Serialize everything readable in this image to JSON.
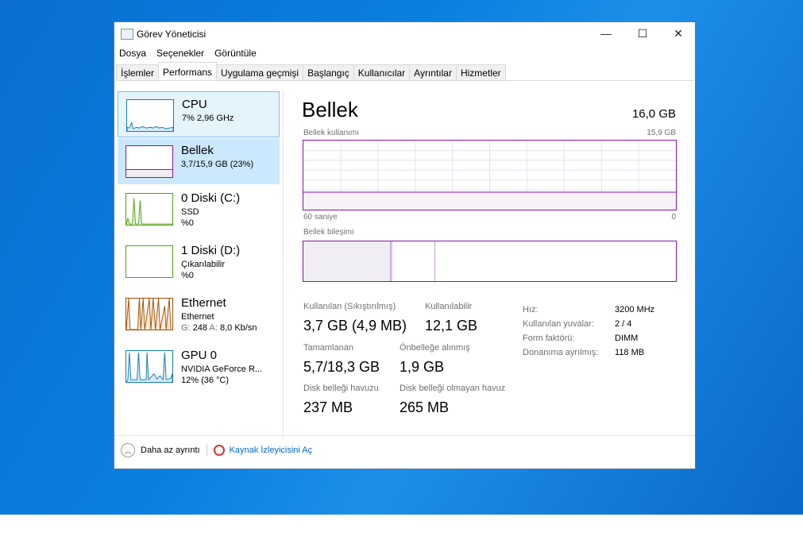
{
  "window": {
    "title": "Görev Yöneticisi",
    "minimize": "—",
    "maximize": "☐",
    "close": "✕"
  },
  "menu": [
    "Dosya",
    "Seçenekler",
    "Görüntüle"
  ],
  "tabs": [
    "İşlemler",
    "Performans",
    "Uygulama geçmişi",
    "Başlangıç",
    "Kullanıcılar",
    "Ayrıntılar",
    "Hizmetler"
  ],
  "sidebar": [
    {
      "name": "CPU",
      "l1": "7% 2,96 GHz",
      "l2": "",
      "color": "#117dbb"
    },
    {
      "name": "Bellek",
      "l1": "3,7/15,9 GB (23%)",
      "l2": "",
      "color": "#8b12ae"
    },
    {
      "name": "0 Diski (C:)",
      "l1": "SSD",
      "l2": "%0",
      "color": "#4da60c"
    },
    {
      "name": "1 Diski (D:)",
      "l1": "Çıkarılabilir",
      "l2": "%0",
      "color": "#4da60c"
    },
    {
      "name": "Ethernet",
      "l1": "Ethernet",
      "l2a": "G:",
      "l2b": "248",
      "l2c": "A:",
      "l2d": "8,0 Kb/sn",
      "color": "#a74f01"
    },
    {
      "name": "GPU 0",
      "l1": "NVIDIA GeForce R...",
      "l2": "12% (36 °C)",
      "color": "#117dbb"
    }
  ],
  "main": {
    "title": "Bellek",
    "total": "16,0 GB",
    "graph_label": "Bellek kullanımı",
    "graph_max": "15,9 GB",
    "graph_left": "60 saniye",
    "graph_right": "0",
    "usage_fraction": 0.23,
    "composition_label": "Bellek bileşimi",
    "stats": [
      {
        "label": "Kullanılan (Sıkıştırılmış)",
        "value": "3,7 GB (4,9 MB)"
      },
      {
        "label": "Kullanılabilir",
        "value": "12,1 GB"
      },
      {
        "label": "Tamamlanan",
        "value": "5,7/18,3 GB"
      },
      {
        "label": "Önbelleğe alınmış",
        "value": "1,9 GB"
      },
      {
        "label": "Disk belleği havuzu",
        "value": "237 MB"
      },
      {
        "label": "Disk belleği olmayan havuz",
        "value": "265 MB"
      }
    ],
    "props": [
      {
        "k": "Hız:",
        "v": "3200 MHz"
      },
      {
        "k": "Kullanılan yuvalar:",
        "v": "2 / 4"
      },
      {
        "k": "Form faktörü:",
        "v": "DIMM"
      },
      {
        "k": "Donanıma ayrılmış:",
        "v": "118 MB"
      }
    ]
  },
  "footer": {
    "less": "Daha az ayrıntı",
    "monitor": "Kaynak İzleyicisini Aç"
  }
}
